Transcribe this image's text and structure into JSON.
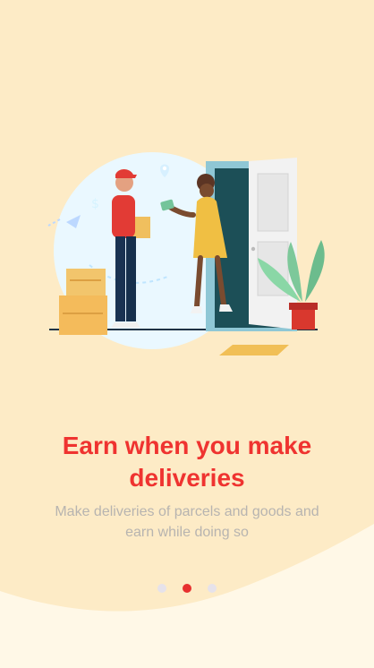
{
  "onboarding": {
    "title": "Earn when you make deliveries",
    "subtitle": "Make deliveries of parcels and goods and earn while doing so",
    "pagination": {
      "total": 3,
      "active_index": 1
    },
    "colors": {
      "background": "#fdebc6",
      "wave": "#fff8e7",
      "accent": "#ef3330",
      "muted_text": "#b7b4b0",
      "inactive_dot": "#e6e2ea"
    }
  }
}
